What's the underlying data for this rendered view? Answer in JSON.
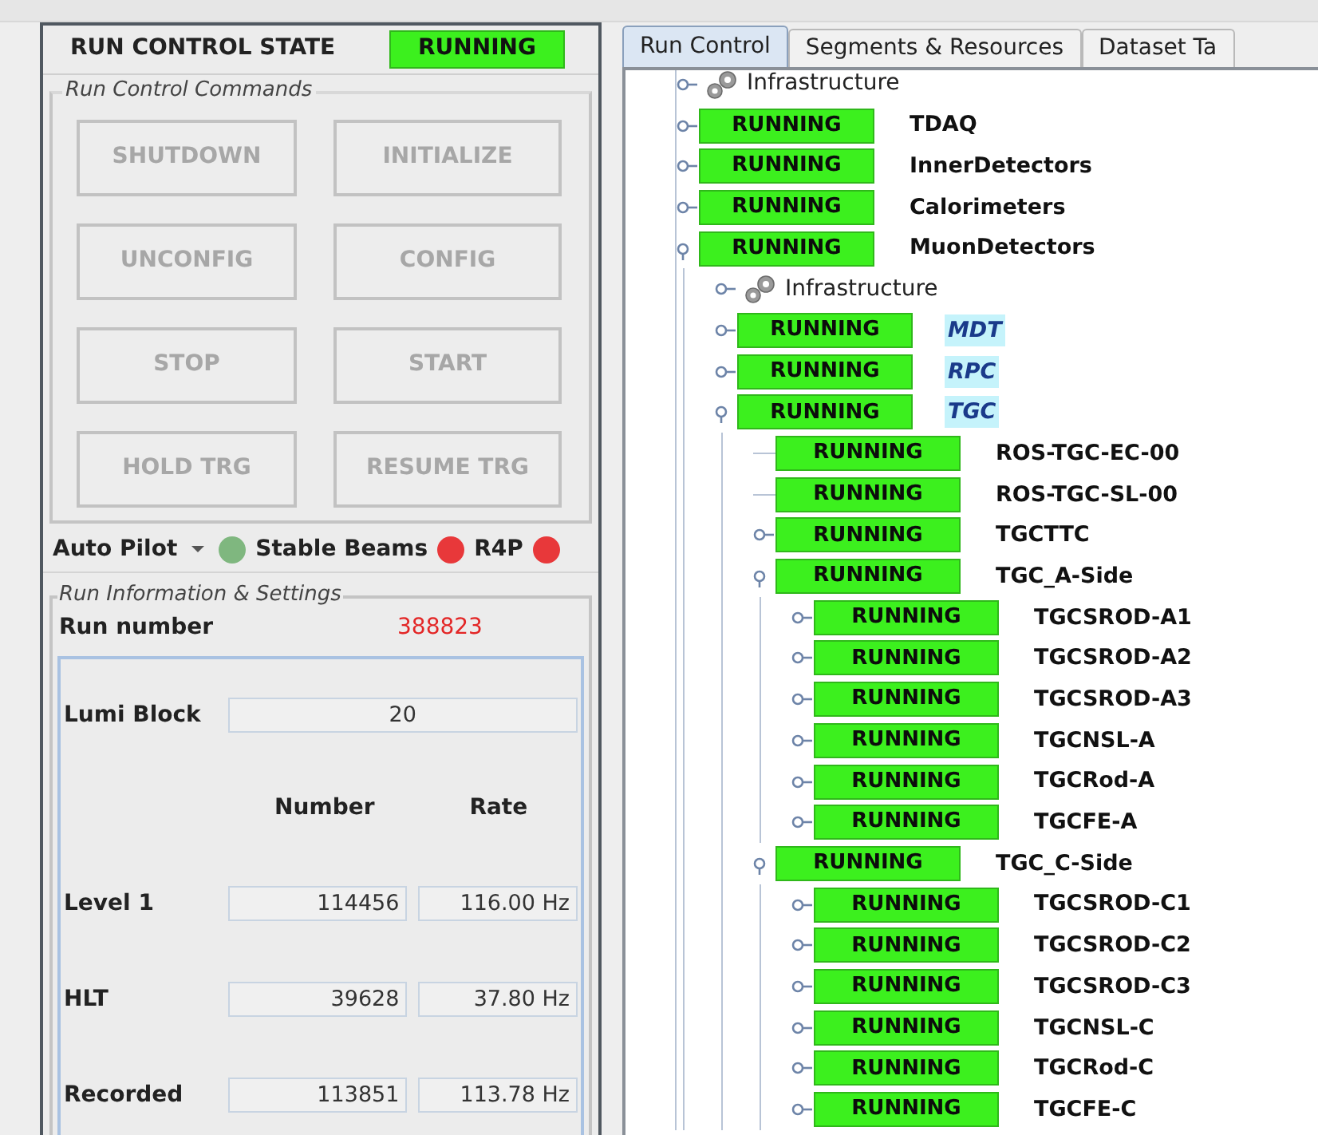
{
  "run_control_state": {
    "label": "RUN CONTROL STATE",
    "state": "RUNNING"
  },
  "commands": {
    "title": "Run Control Commands",
    "buttons": [
      {
        "label": "SHUTDOWN",
        "disabled": true
      },
      {
        "label": "INITIALIZE",
        "disabled": true
      },
      {
        "label": "UNCONFIG",
        "disabled": true
      },
      {
        "label": "CONFIG",
        "disabled": true
      },
      {
        "label": "STOP",
        "disabled": true
      },
      {
        "label": "START",
        "disabled": true
      },
      {
        "label": "HOLD TRG",
        "disabled": true
      },
      {
        "label": "RESUME TRG",
        "disabled": true
      }
    ]
  },
  "status_row": {
    "auto_pilot": "Auto Pilot",
    "indicators": [
      {
        "color": "#7fb77f"
      },
      {
        "label": "Stable Beams",
        "color": "#e8383a"
      },
      {
        "label": "R4P",
        "color": "#e8383a"
      }
    ]
  },
  "run_info": {
    "title": "Run Information & Settings",
    "run_number_label": "Run number",
    "run_number": "388823",
    "lumi_block_label": "Lumi Block",
    "lumi_block": "20",
    "columns": [
      "Number",
      "Rate"
    ],
    "rows": [
      {
        "label": "Level 1",
        "number": "114456",
        "rate": "116.00 Hz"
      },
      {
        "label": "HLT",
        "number": "39628",
        "rate": "37.80 Hz"
      },
      {
        "label": "Recorded",
        "number": "113851",
        "rate": "113.78 Hz"
      }
    ]
  },
  "tabs": [
    {
      "label": "Run Control",
      "selected": true
    },
    {
      "label": "Segments & Resources",
      "selected": false
    },
    {
      "label": "Dataset Ta",
      "selected": false
    }
  ],
  "tree": [
    {
      "kind": "folder",
      "name": "Infrastructure",
      "expanded": false
    },
    {
      "kind": "component",
      "state": "RUNNING",
      "name": "TDAQ",
      "expanded": false
    },
    {
      "kind": "component",
      "state": "RUNNING",
      "name": "InnerDetectors",
      "expanded": false
    },
    {
      "kind": "component",
      "state": "RUNNING",
      "name": "Calorimeters",
      "expanded": false
    },
    {
      "kind": "component",
      "state": "RUNNING",
      "name": "MuonDetectors",
      "expanded": true,
      "children": [
        {
          "kind": "folder",
          "name": "Infrastructure",
          "expanded": false
        },
        {
          "kind": "component",
          "state": "RUNNING",
          "name": "MDT",
          "highlighted": true,
          "expanded": false
        },
        {
          "kind": "component",
          "state": "RUNNING",
          "name": "RPC",
          "highlighted": true,
          "expanded": false
        },
        {
          "kind": "component",
          "state": "RUNNING",
          "name": "TGC",
          "highlighted": true,
          "expanded": true,
          "children": [
            {
              "kind": "component",
              "state": "RUNNING",
              "name": "ROS-TGC-EC-00"
            },
            {
              "kind": "component",
              "state": "RUNNING",
              "name": "ROS-TGC-SL-00"
            },
            {
              "kind": "component",
              "state": "RUNNING",
              "name": "TGCTTC",
              "expanded": false
            },
            {
              "kind": "component",
              "state": "RUNNING",
              "name": "TGC_A-Side",
              "expanded": true,
              "children": [
                {
                  "kind": "component",
                  "state": "RUNNING",
                  "name": "TGCSROD-A1",
                  "expanded": false
                },
                {
                  "kind": "component",
                  "state": "RUNNING",
                  "name": "TGCSROD-A2",
                  "expanded": false
                },
                {
                  "kind": "component",
                  "state": "RUNNING",
                  "name": "TGCSROD-A3",
                  "expanded": false
                },
                {
                  "kind": "component",
                  "state": "RUNNING",
                  "name": "TGCNSL-A",
                  "expanded": false
                },
                {
                  "kind": "component",
                  "state": "RUNNING",
                  "name": "TGCRod-A",
                  "expanded": false
                },
                {
                  "kind": "component",
                  "state": "RUNNING",
                  "name": "TGCFE-A",
                  "expanded": false
                }
              ]
            },
            {
              "kind": "component",
              "state": "RUNNING",
              "name": "TGC_C-Side",
              "expanded": true,
              "children": [
                {
                  "kind": "component",
                  "state": "RUNNING",
                  "name": "TGCSROD-C1",
                  "expanded": false
                },
                {
                  "kind": "component",
                  "state": "RUNNING",
                  "name": "TGCSROD-C2",
                  "expanded": false
                },
                {
                  "kind": "component",
                  "state": "RUNNING",
                  "name": "TGCSROD-C3",
                  "expanded": false
                },
                {
                  "kind": "component",
                  "state": "RUNNING",
                  "name": "TGCNSL-C",
                  "expanded": false
                },
                {
                  "kind": "component",
                  "state": "RUNNING",
                  "name": "TGCRod-C",
                  "expanded": false
                },
                {
                  "kind": "component",
                  "state": "RUNNING",
                  "name": "TGCFE-C",
                  "expanded": false
                }
              ]
            }
          ]
        }
      ]
    }
  ]
}
